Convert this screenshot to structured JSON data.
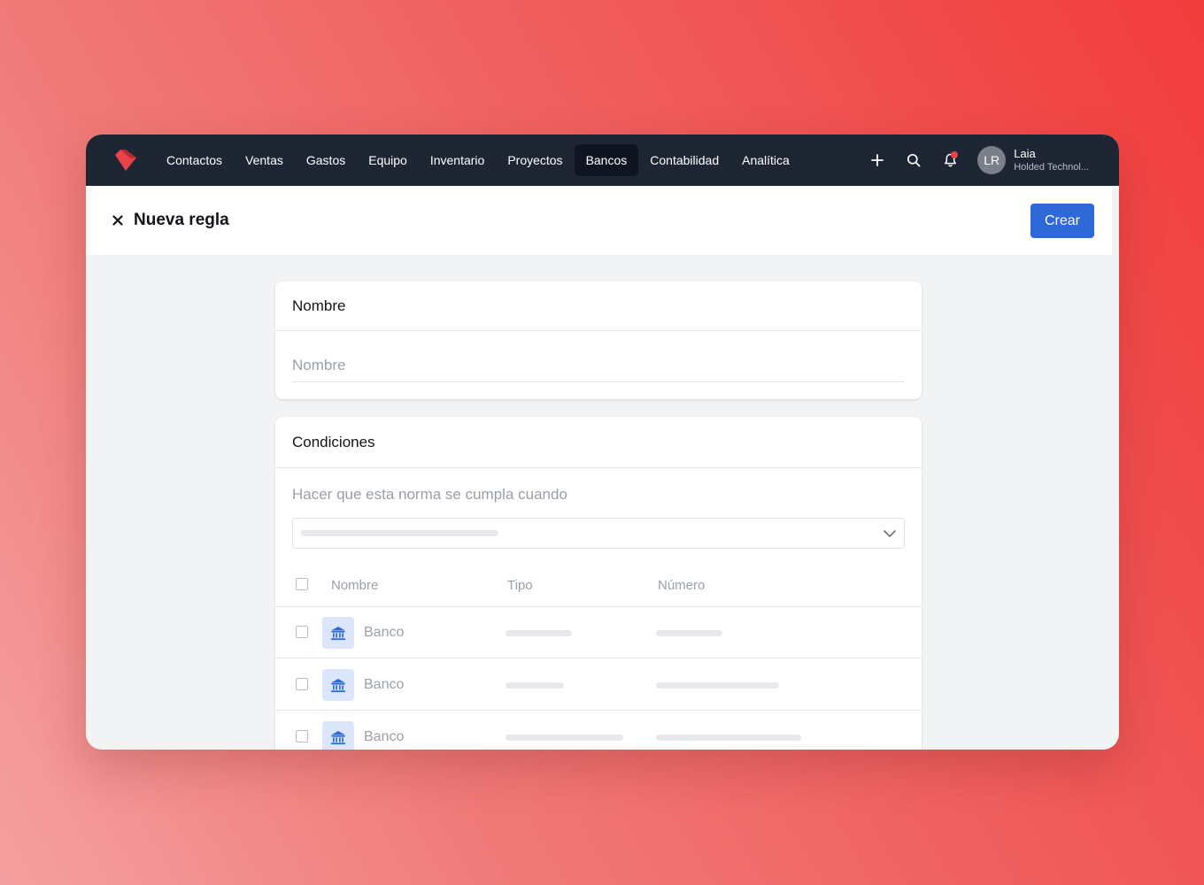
{
  "nav": {
    "items": [
      {
        "label": "Contactos",
        "active": false
      },
      {
        "label": "Ventas",
        "active": false
      },
      {
        "label": "Gastos",
        "active": false
      },
      {
        "label": "Equipo",
        "active": false
      },
      {
        "label": "Inventario",
        "active": false
      },
      {
        "label": "Proyectos",
        "active": false
      },
      {
        "label": "Bancos",
        "active": true
      },
      {
        "label": "Contabilidad",
        "active": false
      },
      {
        "label": "Analítica",
        "active": false
      }
    ],
    "icons": [
      "plus-icon",
      "search-icon",
      "bell-icon"
    ],
    "user": {
      "initials": "LR",
      "name": "Laia",
      "company": "Holded Technol..."
    }
  },
  "header": {
    "title": "Nueva regla",
    "create_label": "Crear"
  },
  "name_card": {
    "title": "Nombre",
    "placeholder": "Nombre"
  },
  "conditions_card": {
    "title": "Condiciones",
    "hint": "Hacer que esta norma se cumpla cuando",
    "columns": [
      "Nombre",
      "Tipo",
      "Número"
    ],
    "rows": [
      {
        "name": "Banco"
      },
      {
        "name": "Banco"
      },
      {
        "name": "Banco"
      }
    ]
  },
  "colors": {
    "topbar": "#1e2634",
    "accent": "#2f68d8",
    "logo": "#e8424a",
    "bank_badge": "#dbe6fb",
    "bank_icon": "#2f68d8"
  }
}
